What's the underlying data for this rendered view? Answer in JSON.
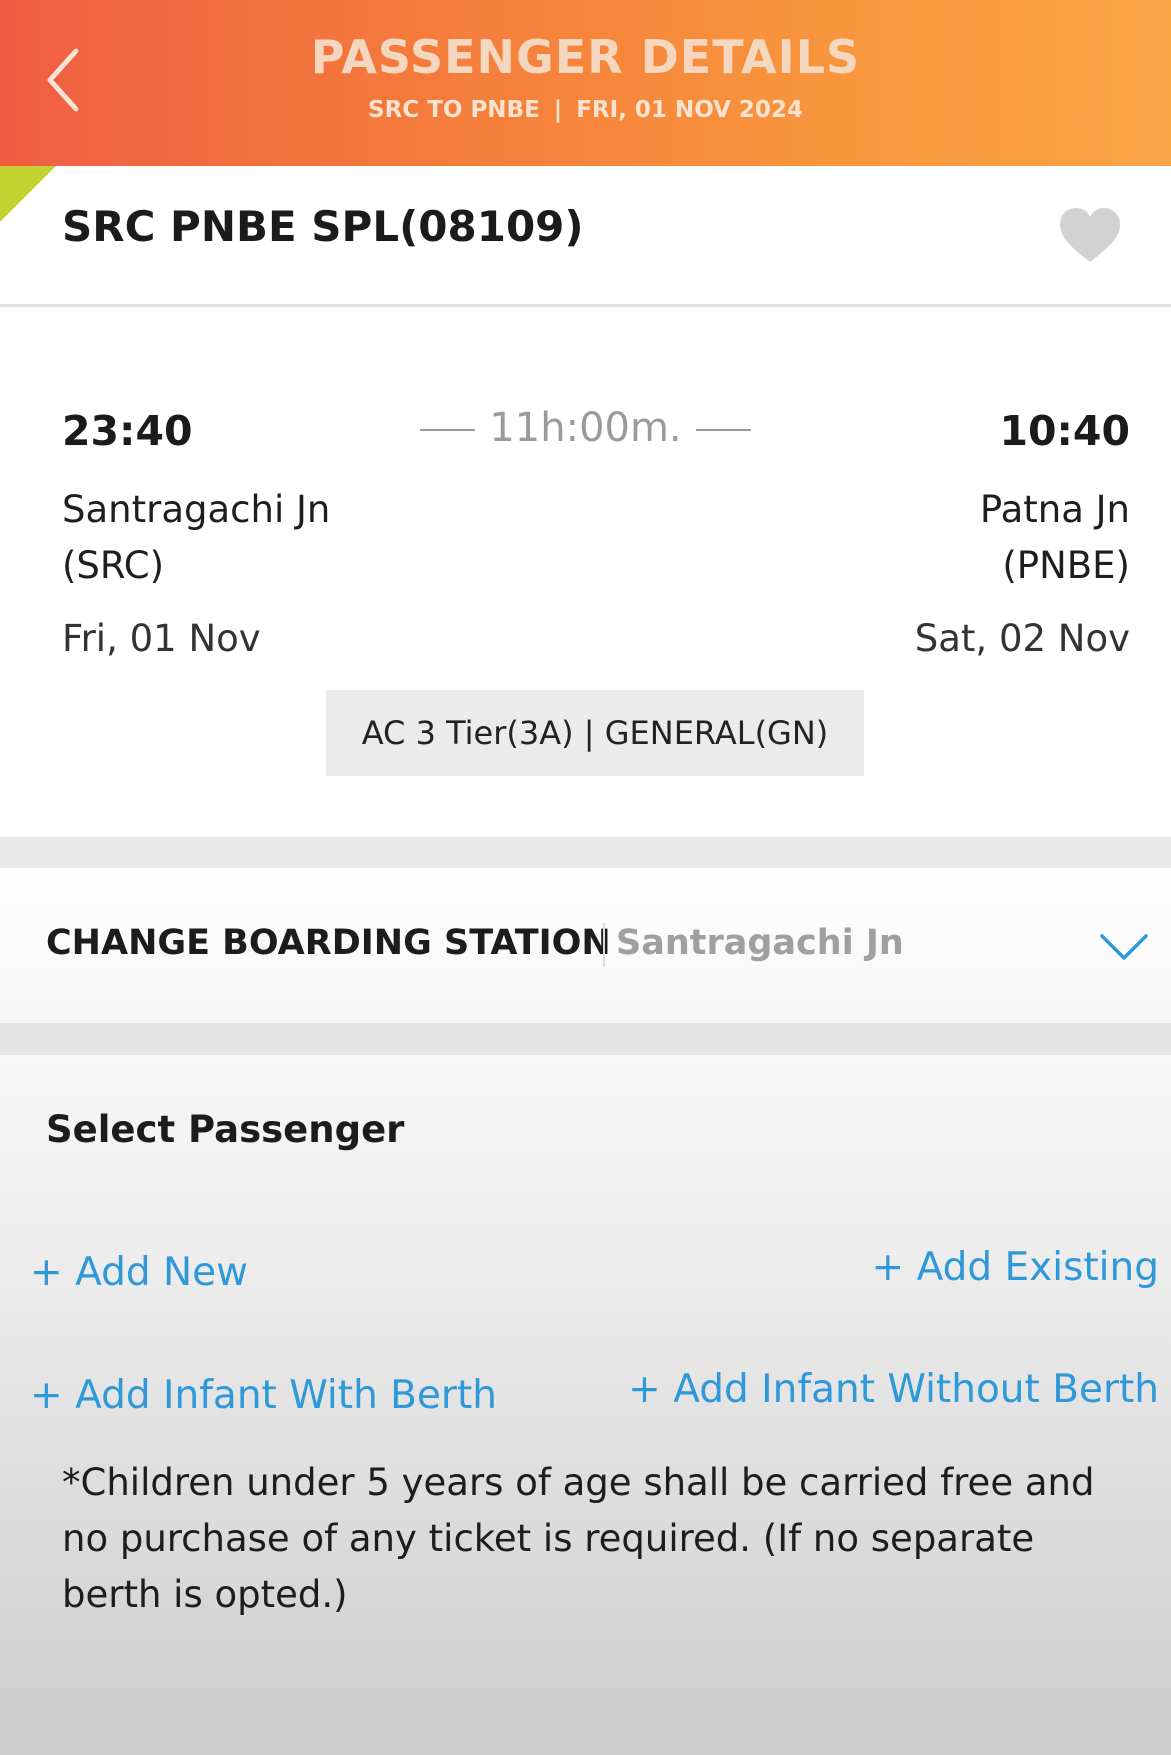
{
  "header": {
    "title": "PASSENGER DETAILS",
    "route": "SRC TO PNBE",
    "separator": "|",
    "date": "FRI, 01 NOV  2024"
  },
  "train": {
    "name": "SRC PNBE SPL(08109)",
    "favorite_icon": "heart-icon"
  },
  "journey": {
    "departure_time": "23:40",
    "arrival_time": "10:40",
    "duration": "11h:00m.",
    "from_station_line1": "Santragachi Jn",
    "from_station_line2": "(SRC)",
    "to_station_line1": "Patna Jn",
    "to_station_line2": "(PNBE)",
    "from_date": "Fri, 01 Nov",
    "to_date": "Sat, 02 Nov",
    "class_quota": "AC 3 Tier(3A) | GENERAL(GN)"
  },
  "boarding": {
    "label": "CHANGE BOARDING STATION",
    "value": "Santragachi Jn",
    "dropdown_icon": "chevron-down-icon"
  },
  "passenger": {
    "title": "Select Passenger",
    "add_new": "+ Add New",
    "add_existing": "+ Add Existing",
    "add_infant_with_berth": "+ Add Infant With Berth",
    "add_infant_without_berth": "+ Add Infant Without Berth",
    "note": "*Children under 5 years of age shall be carried free and no purchase of any ticket is required. (If no separate berth is opted.)"
  },
  "colors": {
    "header_start": "#ef5d43",
    "header_end": "#fba448",
    "link_blue": "#2f98d9",
    "corner_green": "#c2d230"
  }
}
